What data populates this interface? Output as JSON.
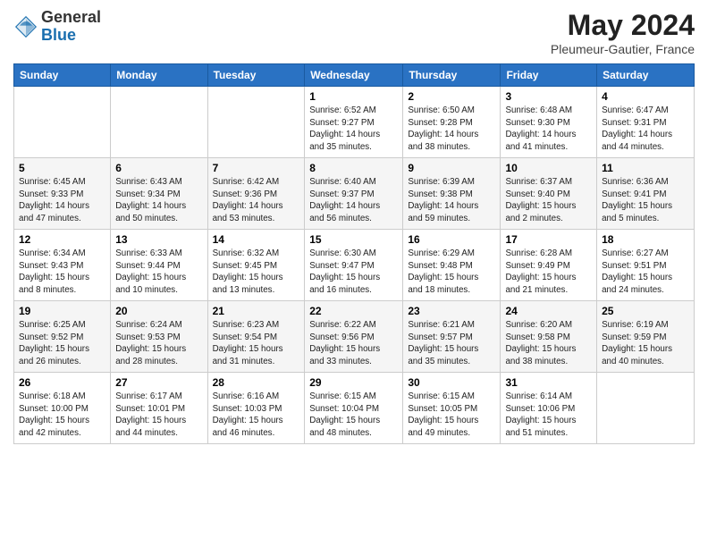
{
  "logo": {
    "general": "General",
    "blue": "Blue"
  },
  "title": {
    "month": "May 2024",
    "location": "Pleumeur-Gautier, France"
  },
  "days_of_week": [
    "Sunday",
    "Monday",
    "Tuesday",
    "Wednesday",
    "Thursday",
    "Friday",
    "Saturday"
  ],
  "weeks": [
    [
      {
        "day": "",
        "info": ""
      },
      {
        "day": "",
        "info": ""
      },
      {
        "day": "",
        "info": ""
      },
      {
        "day": "1",
        "info": "Sunrise: 6:52 AM\nSunset: 9:27 PM\nDaylight: 14 hours\nand 35 minutes."
      },
      {
        "day": "2",
        "info": "Sunrise: 6:50 AM\nSunset: 9:28 PM\nDaylight: 14 hours\nand 38 minutes."
      },
      {
        "day": "3",
        "info": "Sunrise: 6:48 AM\nSunset: 9:30 PM\nDaylight: 14 hours\nand 41 minutes."
      },
      {
        "day": "4",
        "info": "Sunrise: 6:47 AM\nSunset: 9:31 PM\nDaylight: 14 hours\nand 44 minutes."
      }
    ],
    [
      {
        "day": "5",
        "info": "Sunrise: 6:45 AM\nSunset: 9:33 PM\nDaylight: 14 hours\nand 47 minutes."
      },
      {
        "day": "6",
        "info": "Sunrise: 6:43 AM\nSunset: 9:34 PM\nDaylight: 14 hours\nand 50 minutes."
      },
      {
        "day": "7",
        "info": "Sunrise: 6:42 AM\nSunset: 9:36 PM\nDaylight: 14 hours\nand 53 minutes."
      },
      {
        "day": "8",
        "info": "Sunrise: 6:40 AM\nSunset: 9:37 PM\nDaylight: 14 hours\nand 56 minutes."
      },
      {
        "day": "9",
        "info": "Sunrise: 6:39 AM\nSunset: 9:38 PM\nDaylight: 14 hours\nand 59 minutes."
      },
      {
        "day": "10",
        "info": "Sunrise: 6:37 AM\nSunset: 9:40 PM\nDaylight: 15 hours\nand 2 minutes."
      },
      {
        "day": "11",
        "info": "Sunrise: 6:36 AM\nSunset: 9:41 PM\nDaylight: 15 hours\nand 5 minutes."
      }
    ],
    [
      {
        "day": "12",
        "info": "Sunrise: 6:34 AM\nSunset: 9:43 PM\nDaylight: 15 hours\nand 8 minutes."
      },
      {
        "day": "13",
        "info": "Sunrise: 6:33 AM\nSunset: 9:44 PM\nDaylight: 15 hours\nand 10 minutes."
      },
      {
        "day": "14",
        "info": "Sunrise: 6:32 AM\nSunset: 9:45 PM\nDaylight: 15 hours\nand 13 minutes."
      },
      {
        "day": "15",
        "info": "Sunrise: 6:30 AM\nSunset: 9:47 PM\nDaylight: 15 hours\nand 16 minutes."
      },
      {
        "day": "16",
        "info": "Sunrise: 6:29 AM\nSunset: 9:48 PM\nDaylight: 15 hours\nand 18 minutes."
      },
      {
        "day": "17",
        "info": "Sunrise: 6:28 AM\nSunset: 9:49 PM\nDaylight: 15 hours\nand 21 minutes."
      },
      {
        "day": "18",
        "info": "Sunrise: 6:27 AM\nSunset: 9:51 PM\nDaylight: 15 hours\nand 24 minutes."
      }
    ],
    [
      {
        "day": "19",
        "info": "Sunrise: 6:25 AM\nSunset: 9:52 PM\nDaylight: 15 hours\nand 26 minutes."
      },
      {
        "day": "20",
        "info": "Sunrise: 6:24 AM\nSunset: 9:53 PM\nDaylight: 15 hours\nand 28 minutes."
      },
      {
        "day": "21",
        "info": "Sunrise: 6:23 AM\nSunset: 9:54 PM\nDaylight: 15 hours\nand 31 minutes."
      },
      {
        "day": "22",
        "info": "Sunrise: 6:22 AM\nSunset: 9:56 PM\nDaylight: 15 hours\nand 33 minutes."
      },
      {
        "day": "23",
        "info": "Sunrise: 6:21 AM\nSunset: 9:57 PM\nDaylight: 15 hours\nand 35 minutes."
      },
      {
        "day": "24",
        "info": "Sunrise: 6:20 AM\nSunset: 9:58 PM\nDaylight: 15 hours\nand 38 minutes."
      },
      {
        "day": "25",
        "info": "Sunrise: 6:19 AM\nSunset: 9:59 PM\nDaylight: 15 hours\nand 40 minutes."
      }
    ],
    [
      {
        "day": "26",
        "info": "Sunrise: 6:18 AM\nSunset: 10:00 PM\nDaylight: 15 hours\nand 42 minutes."
      },
      {
        "day": "27",
        "info": "Sunrise: 6:17 AM\nSunset: 10:01 PM\nDaylight: 15 hours\nand 44 minutes."
      },
      {
        "day": "28",
        "info": "Sunrise: 6:16 AM\nSunset: 10:03 PM\nDaylight: 15 hours\nand 46 minutes."
      },
      {
        "day": "29",
        "info": "Sunrise: 6:15 AM\nSunset: 10:04 PM\nDaylight: 15 hours\nand 48 minutes."
      },
      {
        "day": "30",
        "info": "Sunrise: 6:15 AM\nSunset: 10:05 PM\nDaylight: 15 hours\nand 49 minutes."
      },
      {
        "day": "31",
        "info": "Sunrise: 6:14 AM\nSunset: 10:06 PM\nDaylight: 15 hours\nand 51 minutes."
      },
      {
        "day": "",
        "info": ""
      }
    ]
  ]
}
